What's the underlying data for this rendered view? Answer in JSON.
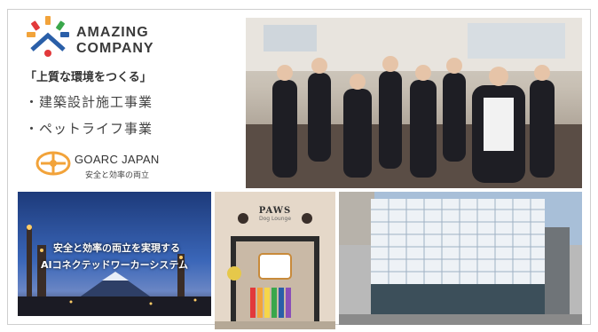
{
  "logo": {
    "line1": "AMAZING",
    "line2": "COMPANY"
  },
  "tagline": "「上質な環境をつくる」",
  "businesses": [
    "・建築設計施工事業",
    "・ペットライフ事業"
  ],
  "goarc": {
    "name": "GOARC JAPAN",
    "sub": "安全と効率の両立"
  },
  "night_photo": {
    "caption_line1": "安全と効率の両立を実現する",
    "caption_line2": "AIコネクテッドワーカーシステム"
  },
  "paws_photo": {
    "title": "PAWS",
    "sub": "Dog Lounge"
  },
  "colors": {
    "accent_orange": "#f2a33a",
    "accent_blue": "#2a5fa8",
    "accent_red": "#e2393b",
    "accent_green": "#3aa74b"
  }
}
